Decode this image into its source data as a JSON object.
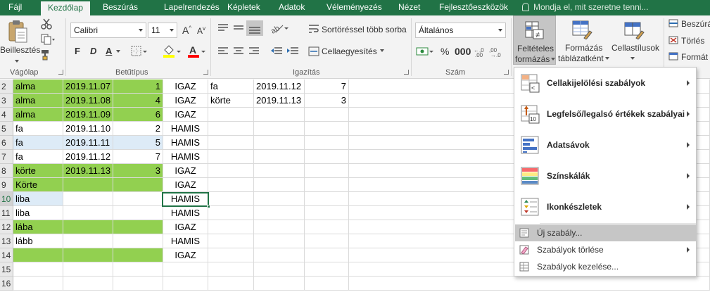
{
  "tabs": {
    "file": "Fájl",
    "items": [
      "Kezdőlap",
      "Beszúrás",
      "Lapelrendezés",
      "Képletek",
      "Adatok",
      "Véleményezés",
      "Nézet",
      "Fejlesztőeszközök"
    ],
    "search_placeholder": "Mondja el, mit szeretne tenni..."
  },
  "ribbon": {
    "clipboard": {
      "paste": "Beillesztés",
      "label": "Vágólap"
    },
    "font": {
      "name": "Calibri",
      "size": "11",
      "bold": "F",
      "italic": "D",
      "underline": "A",
      "label": "Betűtípus",
      "fill_color": "#ffff00",
      "font_color": "#ff0000"
    },
    "alignment": {
      "wrap": "Sortöréssel több sorba",
      "merge": "Cellaegyesítés",
      "label": "Igazítás"
    },
    "number": {
      "format": "Általános",
      "label": "Szám"
    },
    "styles": {
      "cond_line1": "Feltételes",
      "cond_line2": "formázás",
      "table_line1": "Formázás",
      "table_line2": "táblázatként",
      "cell_styles": "Cellastílusok"
    },
    "cells": {
      "insert": "Beszúrá",
      "delete": "Törlés",
      "format": "Formát"
    }
  },
  "colors": {
    "accent": "#217346",
    "green_fill": "#92d050",
    "blue_fill": "#ddebf7"
  },
  "sheet": {
    "rows": [
      {
        "n": "2",
        "a": "alma",
        "b": "2019.11.07",
        "c": "1",
        "d": "IGAZ",
        "e": "fa",
        "f": "2019.11.12",
        "g": "7",
        "fill": "green"
      },
      {
        "n": "3",
        "a": "alma",
        "b": "2019.11.08",
        "c": "4",
        "d": "IGAZ",
        "e": "körte",
        "f": "2019.11.13",
        "g": "3",
        "fill": "green"
      },
      {
        "n": "4",
        "a": "alma",
        "b": "2019.11.09",
        "c": "6",
        "d": "IGAZ",
        "e": "",
        "f": "",
        "g": "",
        "fill": "green"
      },
      {
        "n": "5",
        "a": "fa",
        "b": "2019.11.10",
        "c": "2",
        "d": "HAMIS",
        "e": "",
        "f": "",
        "g": "",
        "fill": "none"
      },
      {
        "n": "6",
        "a": "fa",
        "b": "2019.11.11",
        "c": "5",
        "d": "HAMIS",
        "e": "",
        "f": "",
        "g": "",
        "fill": "blue"
      },
      {
        "n": "7",
        "a": "fa",
        "b": "2019.11.12",
        "c": "7",
        "d": "HAMIS",
        "e": "",
        "f": "",
        "g": "",
        "fill": "none"
      },
      {
        "n": "8",
        "a": "körte",
        "b": "2019.11.13",
        "c": "3",
        "d": "IGAZ",
        "e": "",
        "f": "",
        "g": "",
        "fill": "green"
      },
      {
        "n": "9",
        "a": "Körte",
        "b": "",
        "c": "",
        "d": "IGAZ",
        "e": "",
        "f": "",
        "g": "",
        "fill": "green"
      },
      {
        "n": "10",
        "a": "liba",
        "b": "",
        "c": "",
        "d": "HAMIS",
        "e": "",
        "f": "",
        "g": "",
        "fill": "blue-a"
      },
      {
        "n": "11",
        "a": "liba",
        "b": "",
        "c": "",
        "d": "HAMIS",
        "e": "",
        "f": "",
        "g": "",
        "fill": "none"
      },
      {
        "n": "12",
        "a": "lába",
        "b": "",
        "c": "",
        "d": "IGAZ",
        "e": "",
        "f": "",
        "g": "",
        "fill": "green"
      },
      {
        "n": "13",
        "a": "lább",
        "b": "",
        "c": "",
        "d": "HAMIS",
        "e": "",
        "f": "",
        "g": "",
        "fill": "none"
      },
      {
        "n": "14",
        "a": "",
        "b": "",
        "c": "",
        "d": "IGAZ",
        "e": "",
        "f": "",
        "g": "",
        "fill": "green"
      },
      {
        "n": "15",
        "a": "",
        "b": "",
        "c": "",
        "d": "",
        "e": "",
        "f": "",
        "g": "",
        "fill": "none"
      },
      {
        "n": "16",
        "a": "",
        "b": "",
        "c": "",
        "d": "",
        "e": "",
        "f": "",
        "g": "",
        "fill": "none"
      }
    ]
  },
  "menu": {
    "highlight_rules": "Cellakijelölési szabályok",
    "top_bottom_rules": "Legfelső/legalsó értékek szabályai",
    "data_bars": "Adatsávok",
    "color_scales": "Színskálák",
    "icon_sets": "Ikonkészletek",
    "new_rule": "Új szabály...",
    "clear_rules": "Szabályok törlése",
    "manage_rules": "Szabályok kezelése..."
  }
}
